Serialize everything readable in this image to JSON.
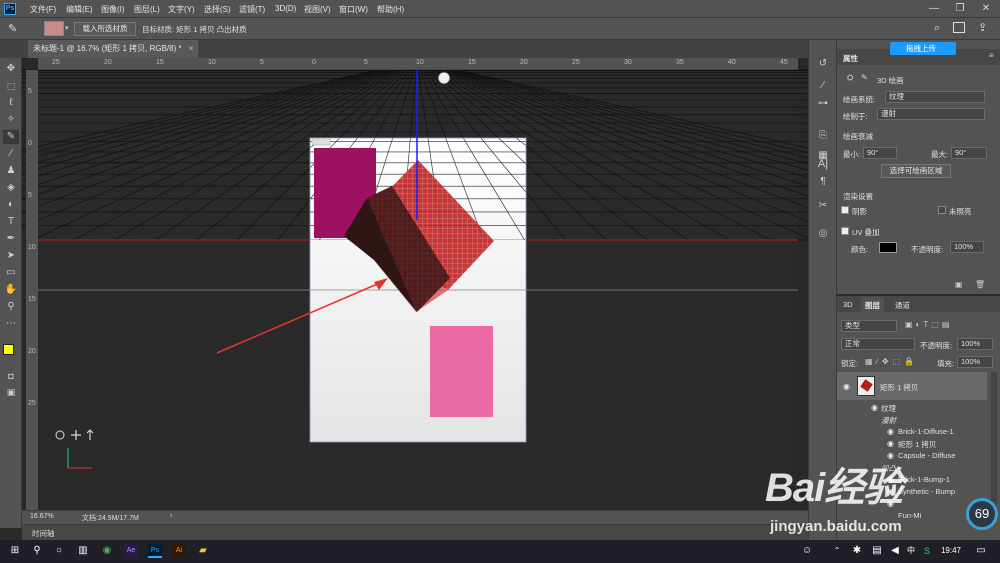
{
  "app": {
    "logo": "Ps"
  },
  "menu": [
    "文件(F)",
    "编辑(E)",
    "图像(I)",
    "图层(L)",
    "文字(Y)",
    "选择(S)",
    "滤镜(T)",
    "3D(D)",
    "视图(V)",
    "窗口(W)",
    "帮助(H)"
  ],
  "window_controls": {
    "minimize": "—",
    "restore": "❐",
    "close": "✕"
  },
  "options_bar": {
    "load_button": "载入所选材质",
    "target_label": "目标材质: 矩形 1 拷贝 凸出材质"
  },
  "document_tab": {
    "label": "未标题-1 @ 16.7% (矩形 1 拷贝, RGB/8) *",
    "close": "×"
  },
  "ruler": {
    "top": [
      "25",
      "20",
      "15",
      "10",
      "5",
      "0",
      "5",
      "10",
      "15",
      "20",
      "25",
      "30",
      "35",
      "40",
      "45"
    ],
    "left": [
      "5",
      "0",
      "5",
      "10",
      "15",
      "20",
      "25"
    ]
  },
  "status": {
    "zoom": "16.67%",
    "doc": "文档:24.9M/17.7M",
    "arrow": "›"
  },
  "timeline": {
    "label": "时间轴"
  },
  "properties": {
    "title": "属性",
    "panel_label": "3D 绘画",
    "paint_system_label": "绘画系统:",
    "paint_system_value": "纹理",
    "paint_on_label": "绘制于:",
    "paint_on_value": "漫射",
    "falloff_label": "绘画衰减",
    "min_label": "最小:",
    "min_value": "90°",
    "max_label": "最大:",
    "max_value": "90°",
    "select_paintable_button": "选择可绘画区域",
    "render_settings_label": "渲染设置",
    "shadow_label": "阴影",
    "unlit_label": "未照亮",
    "uv_overlay_label": "UV 叠加",
    "color_label": "颜色:",
    "opacity_label": "不透明度:",
    "opacity_value": "100%"
  },
  "cloud_button": "拖拽上传",
  "layers": {
    "tabs": [
      "3D",
      "图层",
      "通道"
    ],
    "filter_type": "类型",
    "blend_mode": "正常",
    "opacity_label": "不透明度:",
    "opacity_value": "100%",
    "lock_label": "锁定:",
    "fill_label": "填充:",
    "fill_value": "100%",
    "layer_name": "矩形 1 拷贝",
    "sub_items": [
      "纹理",
      "漫射",
      "Brick-1-Diffuse-1",
      "矩形 1 拷贝",
      "Capsule - Diffuse",
      "凹凸",
      "Brick-1-Bump-1",
      "Synthetic - Bump",
      "Fun-Mi"
    ]
  },
  "watermark": {
    "brand": "Bai经验",
    "url": "jingyan.baidu.com"
  },
  "gauge": {
    "value": "69",
    "unit": "%"
  },
  "taskbar": {
    "time": "19:47",
    "lang": "中",
    "ime": "S"
  },
  "colors": {
    "foreground": "#ffff00",
    "background": "#ffffff",
    "arrow": "#e8342a",
    "accent": "#1e9bff"
  }
}
